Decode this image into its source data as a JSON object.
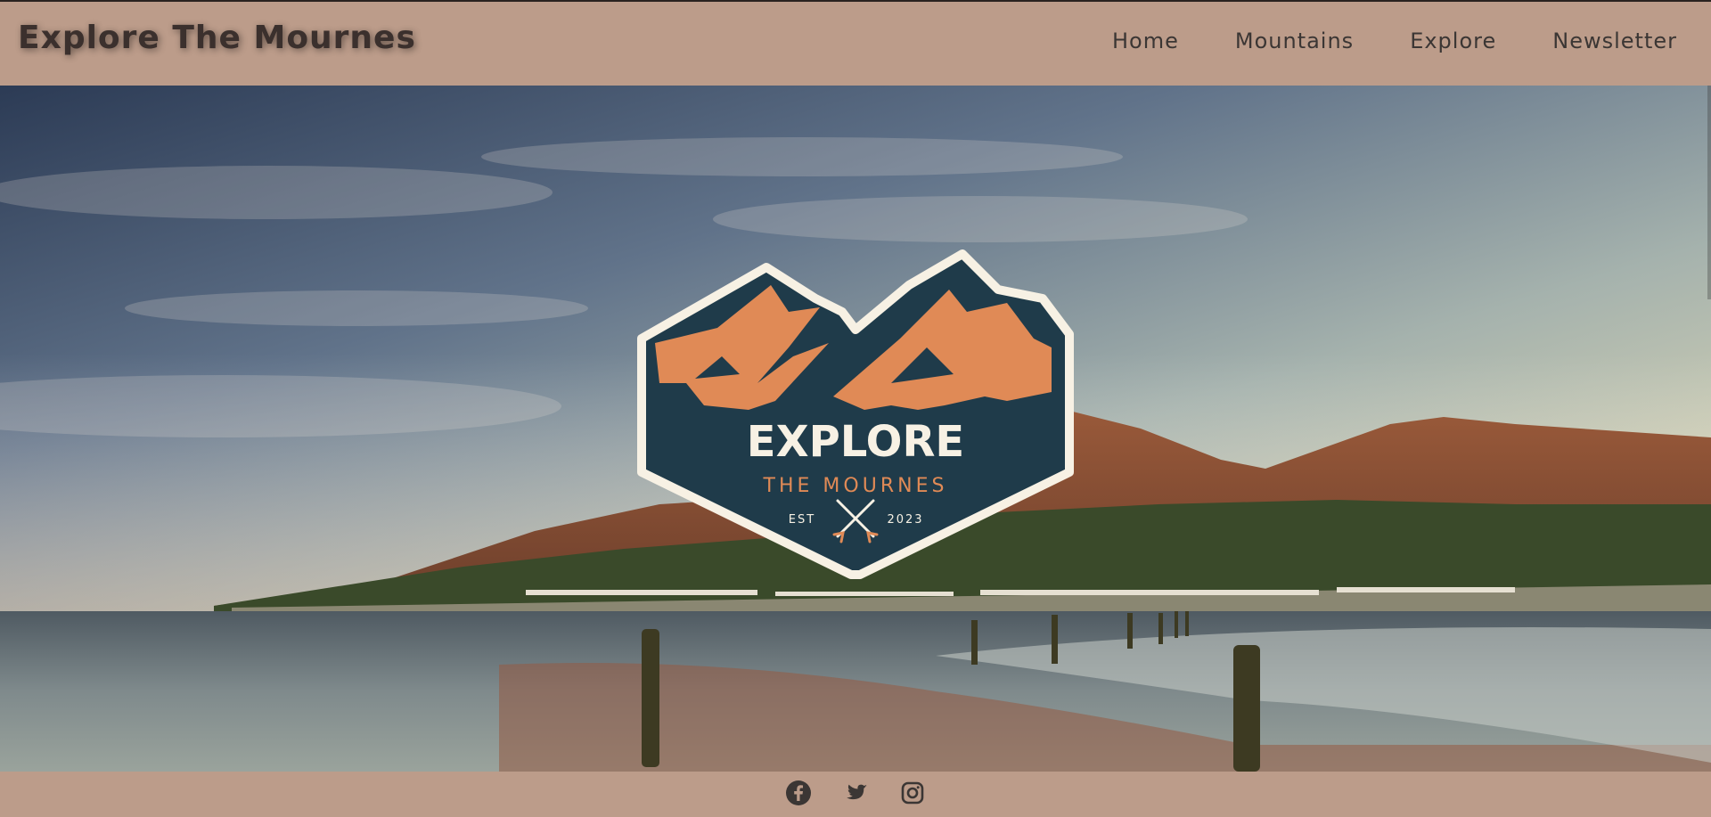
{
  "header": {
    "brand": "Explore The Mournes",
    "nav": [
      "Home",
      "Mountains",
      "Explore",
      "Newsletter"
    ]
  },
  "hero": {
    "logo": {
      "title": "EXPLORE",
      "subtitle": "THE MOURNES",
      "est_label": "EST",
      "est_year": "2023"
    }
  },
  "footer": {
    "social_icons": [
      "facebook-icon",
      "twitter-icon",
      "instagram-icon"
    ]
  },
  "colors": {
    "bar": "#bc9c8a",
    "brand_text": "#3b302d",
    "logo_navy": "#1f3b4a",
    "logo_orange": "#e08a56",
    "logo_cream": "#f7f1e4"
  }
}
